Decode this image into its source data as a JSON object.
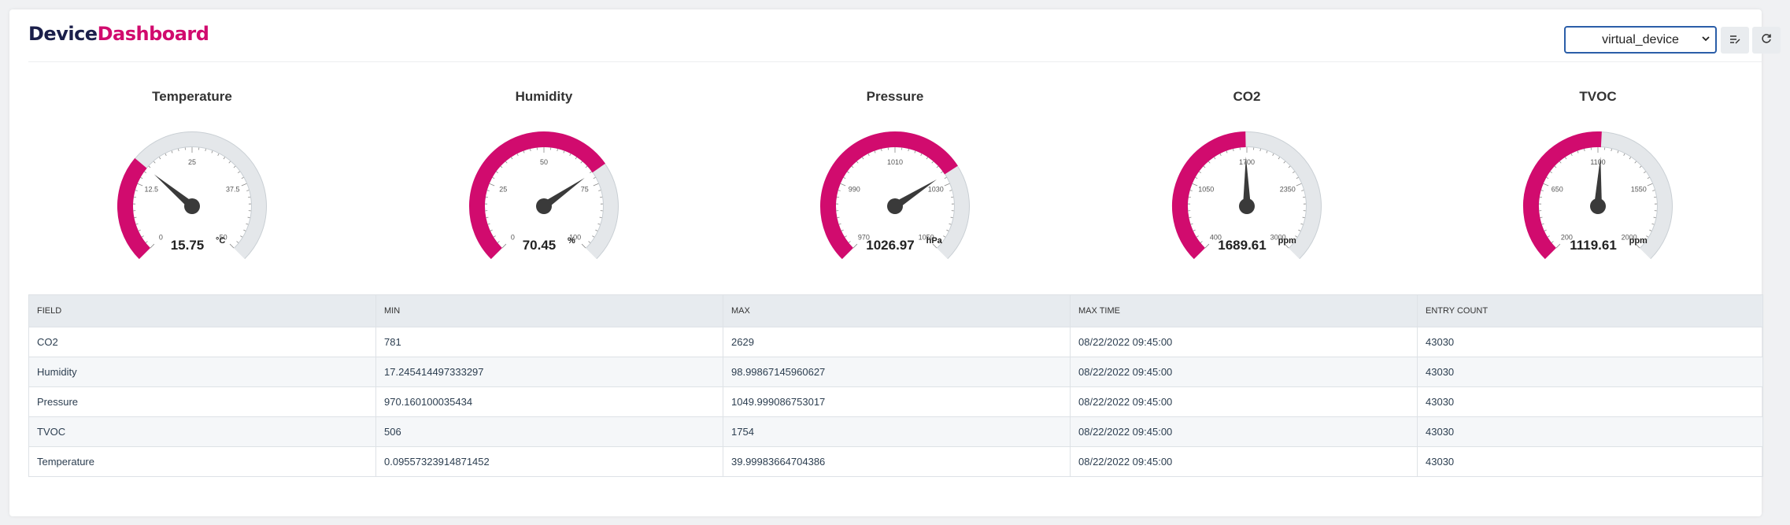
{
  "header": {
    "brand_part1": "Device",
    "brand_part2": "Dashboard",
    "device_select_value": "virtual_device",
    "list_icon": "list-edit-icon",
    "refresh_icon": "refresh-icon"
  },
  "colors": {
    "accent": "#d10b6e",
    "gauge_track": "#e4e7ea",
    "needle": "#3a3a3a"
  },
  "gauges": [
    {
      "title": "Temperature",
      "value": "15.75",
      "unit": "°C",
      "min": 0,
      "max": 50,
      "fill": 15.75,
      "ticks": [
        "0",
        "12.5",
        "25",
        "37.5",
        "50"
      ]
    },
    {
      "title": "Humidity",
      "value": "70.45",
      "unit": "%",
      "min": 0,
      "max": 100,
      "fill": 70.45,
      "ticks": [
        "0",
        "25",
        "50",
        "75",
        "100"
      ]
    },
    {
      "title": "Pressure",
      "value": "1026.97",
      "unit": "hPa",
      "min": 970,
      "max": 1050,
      "fill": 1026.97,
      "ticks": [
        "970",
        "990",
        "1010",
        "1030",
        "1050"
      ]
    },
    {
      "title": "CO2",
      "value": "1689.61",
      "unit": "ppm",
      "min": 400,
      "max": 3000,
      "fill": 1689.61,
      "ticks": [
        "400",
        "1050",
        "1700",
        "2350",
        "3000"
      ]
    },
    {
      "title": "TVOC",
      "value": "1119.61",
      "unit": "ppm",
      "min": 200,
      "max": 2000,
      "fill": 1119.61,
      "ticks": [
        "200",
        "650",
        "1100",
        "1550",
        "2000"
      ]
    }
  ],
  "table": {
    "headers": [
      "FIELD",
      "MIN",
      "MAX",
      "MAX TIME",
      "ENTRY COUNT"
    ],
    "rows": [
      [
        "CO2",
        "781",
        "2629",
        "08/22/2022 09:45:00",
        "43030"
      ],
      [
        "Humidity",
        "17.245414497333297",
        "98.99867145960627",
        "08/22/2022 09:45:00",
        "43030"
      ],
      [
        "Pressure",
        "970.160100035434",
        "1049.999086753017",
        "08/22/2022 09:45:00",
        "43030"
      ],
      [
        "TVOC",
        "506",
        "1754",
        "08/22/2022 09:45:00",
        "43030"
      ],
      [
        "Temperature",
        "0.09557323914871452",
        "39.99983664704386",
        "08/22/2022 09:45:00",
        "43030"
      ]
    ]
  }
}
